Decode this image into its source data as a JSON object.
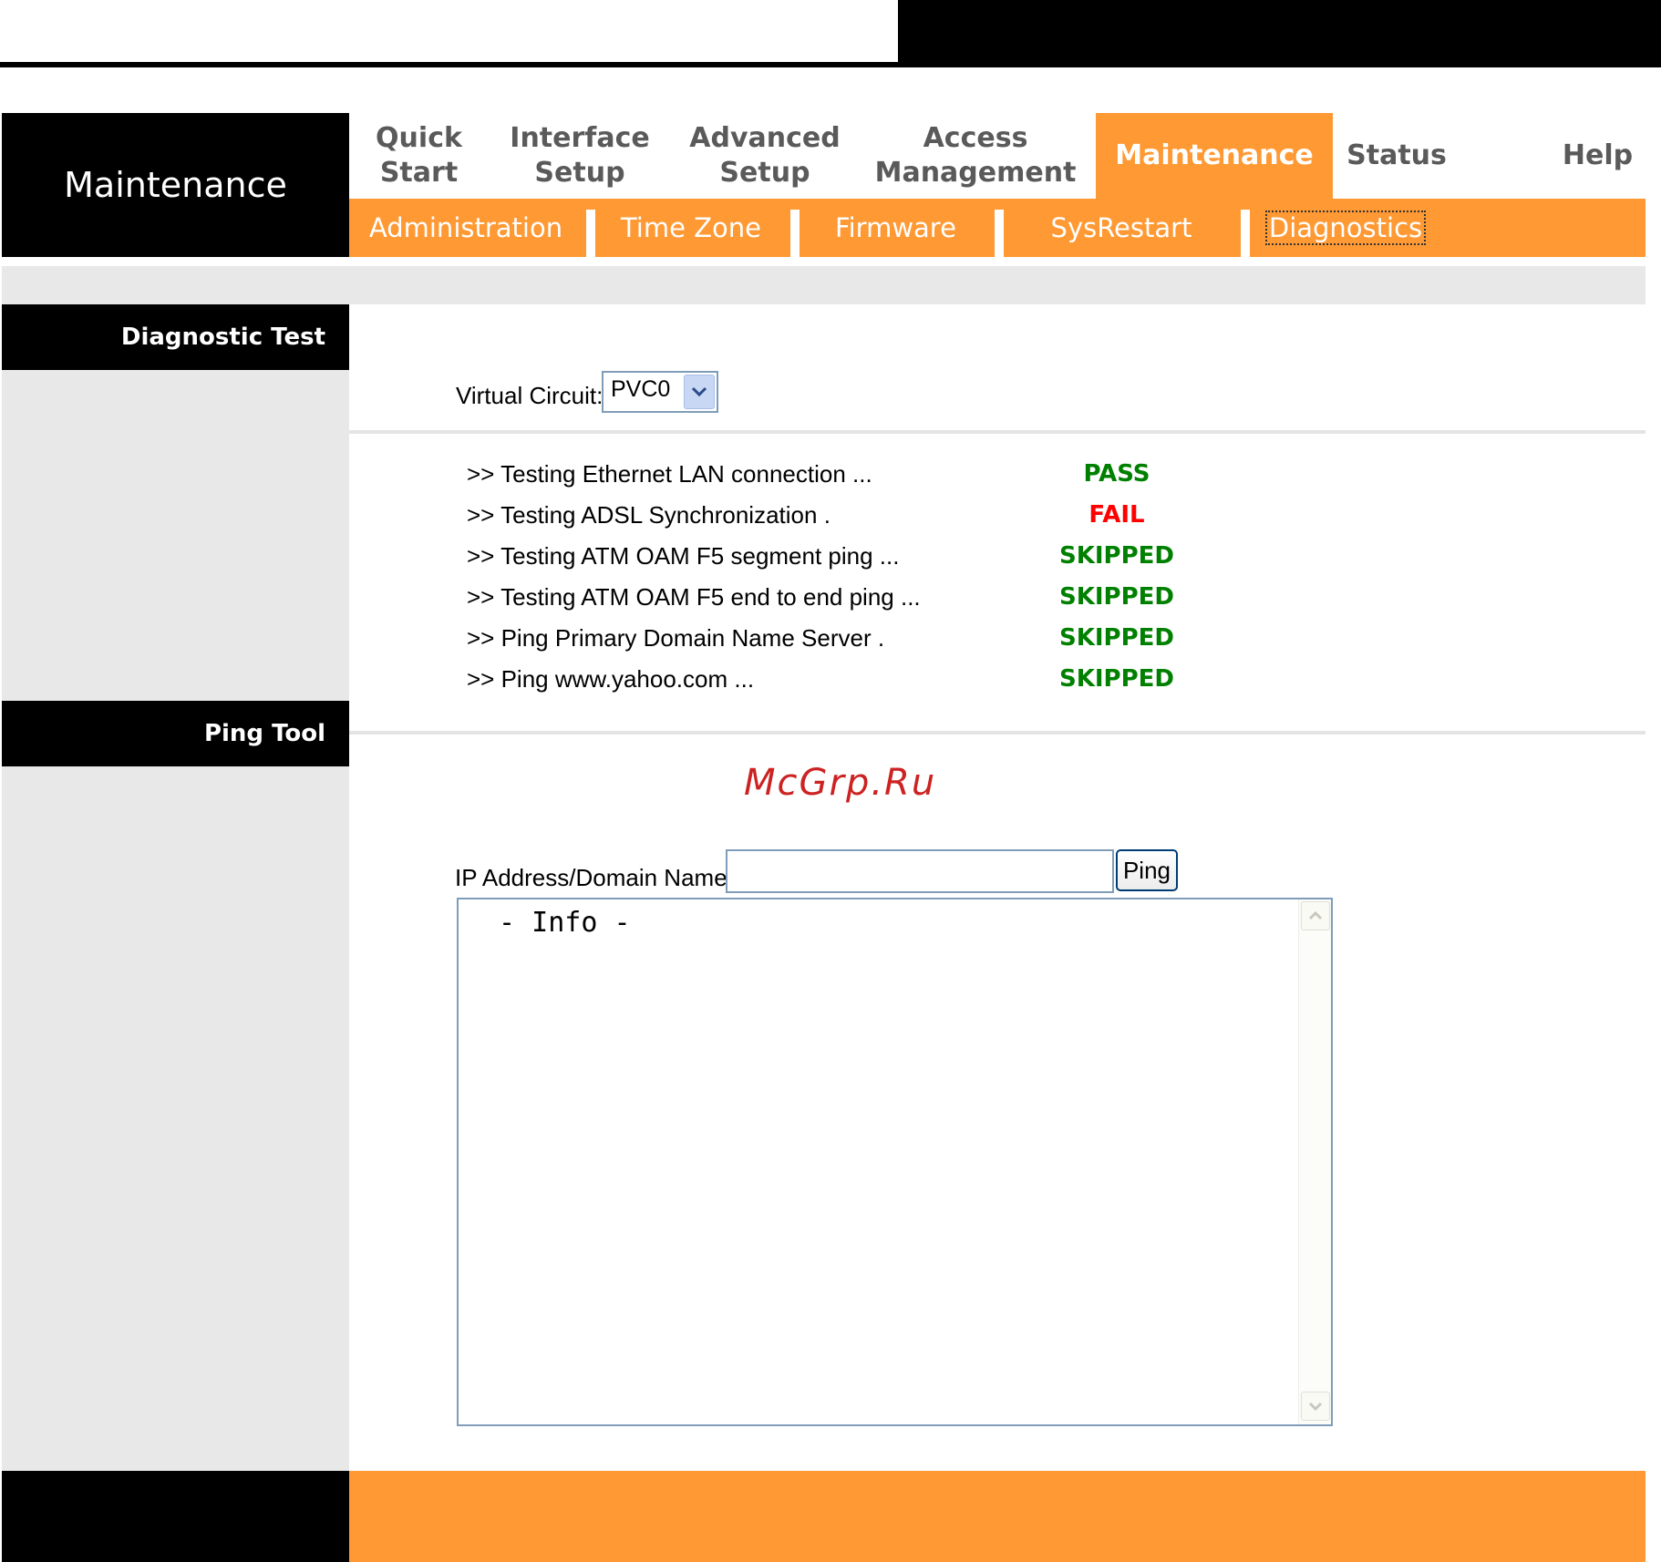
{
  "header": {
    "section_title": "Maintenance",
    "nav": [
      {
        "label": "Quick\nStart"
      },
      {
        "label": "Interface\nSetup"
      },
      {
        "label": "Advanced\nSetup"
      },
      {
        "label": "Access\nManagement"
      },
      {
        "label": "Maintenance"
      },
      {
        "label": "Status"
      },
      {
        "label": "Help"
      }
    ],
    "active_nav": "Maintenance",
    "subnav": [
      {
        "label": "Administration"
      },
      {
        "label": "Time Zone"
      },
      {
        "label": "Firmware"
      },
      {
        "label": "SysRestart"
      },
      {
        "label": "Diagnostics"
      }
    ],
    "active_subnav": "Diagnostics"
  },
  "diagnostic_test": {
    "heading": "Diagnostic Test",
    "virtual_circuit_label": "Virtual Circuit:",
    "virtual_circuit_value": "PVC0",
    "tests": [
      {
        "text": ">> Testing Ethernet LAN connection ...",
        "result": "PASS"
      },
      {
        "text": ">> Testing ADSL Synchronization .",
        "result": "FAIL"
      },
      {
        "text": ">> Testing ATM OAM F5 segment ping ...",
        "result": "SKIPPED"
      },
      {
        "text": ">> Testing ATM OAM F5 end to end ping ...",
        "result": "SKIPPED"
      },
      {
        "text": ">> Ping Primary Domain Name Server .",
        "result": "SKIPPED"
      },
      {
        "text": ">> Ping www.yahoo.com ...",
        "result": "SKIPPED"
      }
    ]
  },
  "ping_tool": {
    "heading": "Ping Tool",
    "ip_label": "IP Address/Domain Name:",
    "ip_value": "",
    "ping_button": "Ping",
    "info_text": " - Info -"
  },
  "watermark": "McGrp.Ru",
  "colors": {
    "accent": "#ff9933",
    "pass": "#008000",
    "fail": "#ff0000",
    "skipped": "#008000"
  }
}
